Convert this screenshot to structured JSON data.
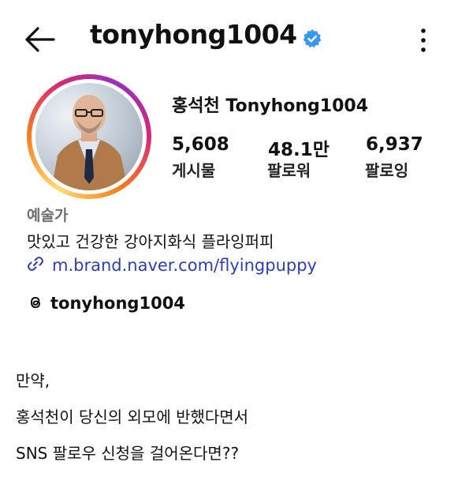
{
  "header": {
    "username": "tonyhong1004",
    "back_icon": "arrow-left-icon",
    "verified_icon": "verified-badge-icon",
    "more_icon": "more-vertical-icon"
  },
  "profile": {
    "display_name": "홍석천 Tonyhong1004",
    "stats": [
      {
        "value": "5,608",
        "label": "게시물"
      },
      {
        "value": "48.1만",
        "label": "팔로워"
      },
      {
        "value": "6,937",
        "label": "팔로잉"
      }
    ],
    "category": "예술가",
    "bio": "맛있고 건강한 강아지화식 플라잉퍼피",
    "link": "m.brand.naver.com/flyingpuppy",
    "threads_handle": "tonyhong1004"
  },
  "caption": {
    "line1": "만약,",
    "line2": "홍석천이 당신의 외모에 반했다면서",
    "line3": "SNS 팔로우 신청을 걸어온다면??"
  },
  "colors": {
    "link": "#2e3fb3",
    "verified": "#3897f0",
    "category": "#6f6f6f"
  }
}
